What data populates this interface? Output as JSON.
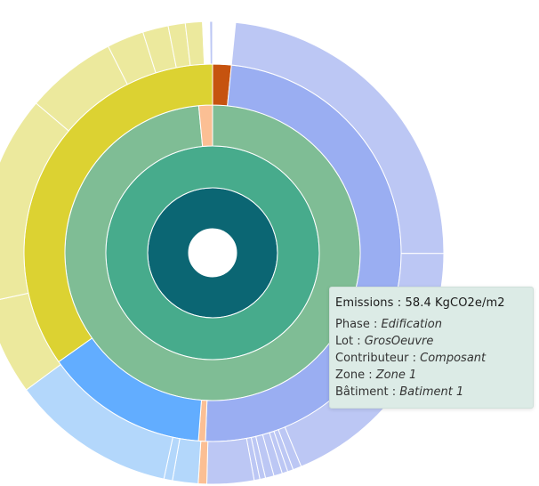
{
  "chart_data": {
    "type": "sunburst",
    "rings": [
      [
        {
          "value": 1,
          "color": "#0b6673"
        }
      ],
      [
        {
          "value": 1,
          "color": "#47ab8c"
        }
      ],
      [
        {
          "value": 0.985,
          "color": "#7fbd95"
        },
        {
          "value": 0.015,
          "color": "#fbbf94"
        }
      ],
      [
        {
          "value": 0.016,
          "color": "#c6530f"
        },
        {
          "value": 0.49,
          "color": "#9aaef2"
        },
        {
          "value": 0.006,
          "color": "#fbbf94"
        },
        {
          "value": 0.14,
          "color": "#62adff"
        },
        {
          "value": 0.348,
          "color": "#dcd232"
        }
      ],
      [
        {
          "value": 0.016,
          "color": "#ffffff"
        },
        {
          "value": 0.236,
          "color": "#bcc7f4"
        },
        {
          "value": 0.188,
          "color": "#bcc7f4"
        },
        {
          "value": 0.006,
          "color": "#bcc7f4"
        },
        {
          "value": 0.004,
          "color": "#bcc7f4"
        },
        {
          "value": 0.004,
          "color": "#bcc7f4"
        },
        {
          "value": 0.006,
          "color": "#bcc7f4"
        },
        {
          "value": 0.006,
          "color": "#bcc7f4"
        },
        {
          "value": 0.004,
          "color": "#bcc7f4"
        },
        {
          "value": 0.004,
          "color": "#bcc7f4"
        },
        {
          "value": 0.033,
          "color": "#bcc7f4"
        },
        {
          "value": 0.006,
          "color": "#fbbf94"
        },
        {
          "value": 0.018,
          "color": "#b3d7fb"
        },
        {
          "value": 0.006,
          "color": "#b3d7fb"
        },
        {
          "value": 0.116,
          "color": "#b3d7fb"
        },
        {
          "value": 0.067,
          "color": "#ece99d"
        },
        {
          "value": 0.147,
          "color": "#ece99d"
        },
        {
          "value": 0.064,
          "color": "#ece99d"
        },
        {
          "value": 0.026,
          "color": "#ece99d"
        },
        {
          "value": 0.018,
          "color": "#ece99d"
        },
        {
          "value": 0.012,
          "color": "#ece99d"
        },
        {
          "value": 0.012,
          "color": "#ece99d"
        },
        {
          "value": 0.005,
          "color": "#ffffff"
        },
        {
          "value": 0.002,
          "color": "#bcc7f4"
        }
      ]
    ]
  },
  "tooltip": {
    "title_label": "Emissions :",
    "title_value": "58.4 KgCO2e/m2",
    "rows": [
      {
        "label": "Phase :",
        "value": "Edification"
      },
      {
        "label": "Lot :",
        "value": "GrosOeuvre"
      },
      {
        "label": "Contributeur :",
        "value": "Composant"
      },
      {
        "label": "Zone :",
        "value": "Zone 1"
      },
      {
        "label": "Bâtiment :",
        "value": "Batiment 1"
      }
    ]
  }
}
